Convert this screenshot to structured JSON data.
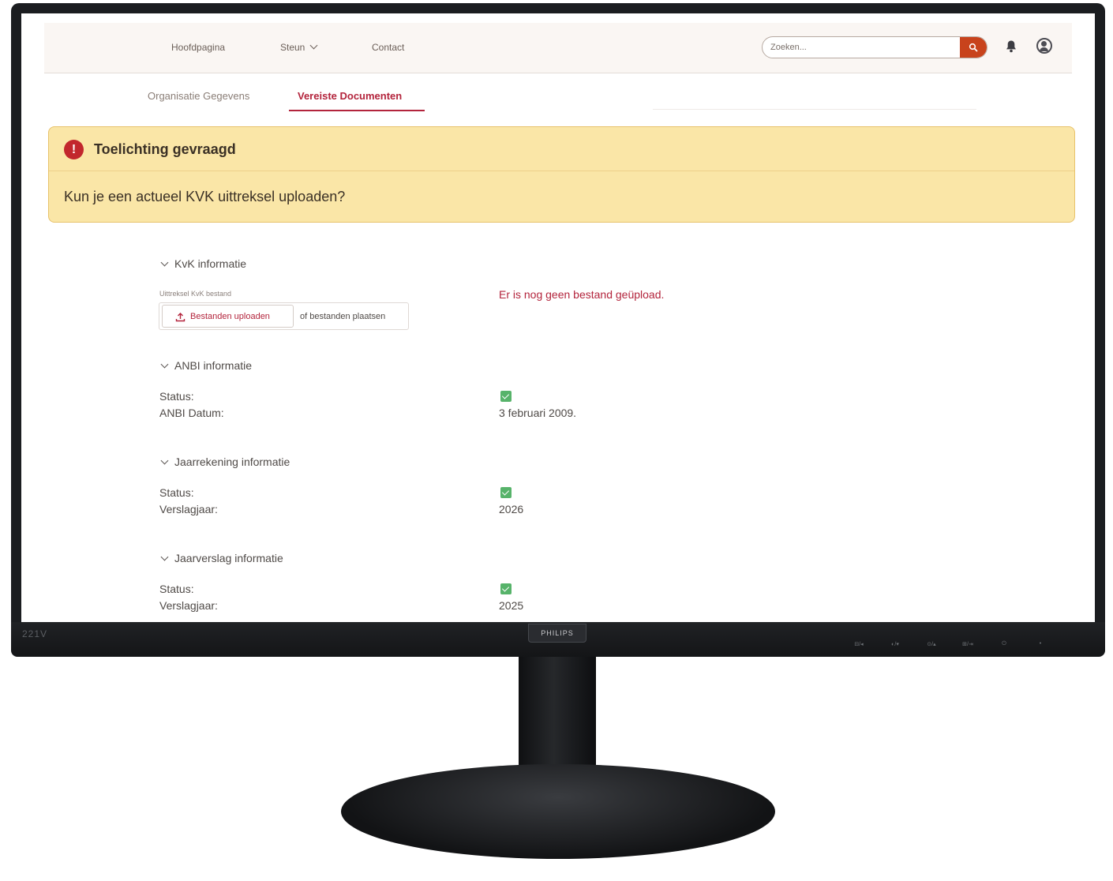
{
  "monitor": {
    "brand": "PHILIPS",
    "model": "221V",
    "buttons": [
      "⊟/◂",
      "◐/▾",
      "⊙/▴",
      "⊞/⇥",
      "⏻",
      "•"
    ]
  },
  "nav": {
    "home": "Hoofdpagina",
    "steun": "Steun",
    "contact": "Contact",
    "search_placeholder": "Zoeken..."
  },
  "tabs": {
    "org": "Organisatie Gegevens",
    "docs": "Vereiste Documenten"
  },
  "alert": {
    "title": "Toelichting gevraagd",
    "message": "Kun je een actueel KVK uittreksel uploaden?",
    "icon_glyph": "!"
  },
  "kvk": {
    "heading": "KvK informatie",
    "file_label": "Uittreksel KvK bestand",
    "upload_button": "Bestanden uploaden",
    "drop_text": "of bestanden plaatsen",
    "error": "Er is nog geen bestand geüpload."
  },
  "anbi": {
    "heading": "ANBI informatie",
    "status_label": "Status:",
    "status_checked": true,
    "date_label": "ANBI Datum:",
    "date_value": "3 februari 2009."
  },
  "jaarrekening": {
    "heading": "Jaarrekening informatie",
    "status_label": "Status:",
    "status_checked": true,
    "year_label": "Verslagjaar:",
    "year_value": "2026"
  },
  "jaarverslag": {
    "heading": "Jaarverslag informatie",
    "status_label": "Status:",
    "status_checked": true,
    "year_label": "Verslagjaar:",
    "year_value": "2025"
  },
  "colors": {
    "accent": "#b3243c",
    "search_button": "#c8431c",
    "alert_bg": "#fae6a7",
    "check": "#57b36a"
  }
}
